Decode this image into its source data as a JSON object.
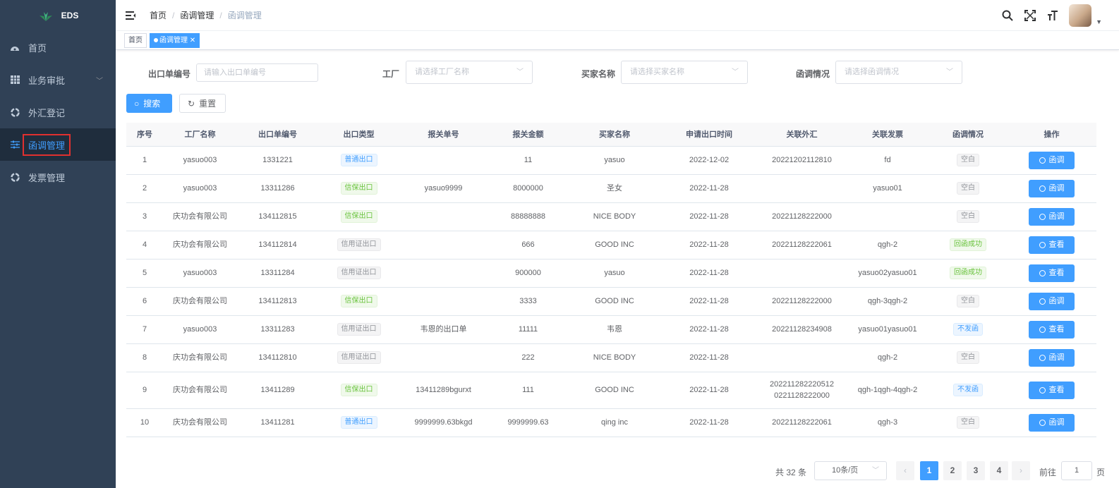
{
  "sidebar": {
    "logo_text": "EDS",
    "items": [
      {
        "label": "首页",
        "icon": "dashboard-icon"
      },
      {
        "label": "业务审批",
        "icon": "table-icon",
        "has_arrow": true
      },
      {
        "label": "外汇登记",
        "icon": "cycle-icon"
      },
      {
        "label": "函调管理",
        "icon": "sliders-icon",
        "active": true
      },
      {
        "label": "发票管理",
        "icon": "cycle-icon"
      }
    ]
  },
  "navbar": {
    "breadcrumb": [
      "首页",
      "函调管理",
      "函调管理"
    ]
  },
  "tags": {
    "home": "首页",
    "active": "函调管理"
  },
  "filters": {
    "export_no": {
      "label": "出口单编号",
      "placeholder": "请输入出口单编号"
    },
    "factory": {
      "label": "工厂",
      "placeholder": "请选择工厂名称"
    },
    "buyer": {
      "label": "买家名称",
      "placeholder": "请选择买家名称"
    },
    "letter_status": {
      "label": "函调情况",
      "placeholder": "请选择函调情况"
    }
  },
  "buttons": {
    "search": "搜索",
    "reset": "重置"
  },
  "table": {
    "headers": [
      "序号",
      "工厂名称",
      "出口单编号",
      "出口类型",
      "报关单号",
      "报关金额",
      "买家名称",
      "申请出口时间",
      "关联外汇",
      "关联发票",
      "函调情况",
      "操作"
    ],
    "rows": [
      {
        "no": "1",
        "factory": "yasuo003",
        "export_no": "1331221",
        "type": "普通出口",
        "type_color": "blue",
        "customs_no": "",
        "amount": "11",
        "buyer": "yasuo",
        "date": "2022-12-02",
        "fx": "20221202112810",
        "invoice": "fd",
        "status": "空白",
        "status_color": "gray",
        "op": "函调"
      },
      {
        "no": "2",
        "factory": "yasuo003",
        "export_no": "13311286",
        "type": "信保出口",
        "type_color": "green",
        "customs_no": "yasuo9999",
        "amount": "8000000",
        "buyer": "圣女",
        "date": "2022-11-28",
        "fx": "",
        "invoice": "yasuo01",
        "status": "空白",
        "status_color": "gray",
        "op": "函调"
      },
      {
        "no": "3",
        "factory": "庆功会有限公司",
        "export_no": "134112815",
        "type": "信保出口",
        "type_color": "green",
        "customs_no": "",
        "amount": "88888888",
        "buyer": "NICE BODY",
        "date": "2022-11-28",
        "fx": "20221128222000",
        "invoice": "",
        "status": "空白",
        "status_color": "gray",
        "op": "函调"
      },
      {
        "no": "4",
        "factory": "庆功会有限公司",
        "export_no": "134112814",
        "type": "信用证出口",
        "type_color": "gray",
        "customs_no": "",
        "amount": "666",
        "buyer": "GOOD INC",
        "date": "2022-11-28",
        "fx": "20221128222061",
        "invoice": "qgh-2",
        "status": "回函成功",
        "status_color": "green",
        "op": "查看"
      },
      {
        "no": "5",
        "factory": "yasuo003",
        "export_no": "13311284",
        "type": "信用证出口",
        "type_color": "gray",
        "customs_no": "",
        "amount": "900000",
        "buyer": "yasuo",
        "date": "2022-11-28",
        "fx": "",
        "invoice": "yasuo02yasuo01",
        "status": "回函成功",
        "status_color": "green",
        "op": "查看"
      },
      {
        "no": "6",
        "factory": "庆功会有限公司",
        "export_no": "134112813",
        "type": "信保出口",
        "type_color": "green",
        "customs_no": "",
        "amount": "3333",
        "buyer": "GOOD INC",
        "date": "2022-11-28",
        "fx": "20221128222000",
        "invoice": "qgh-3qgh-2",
        "status": "空白",
        "status_color": "gray",
        "op": "函调"
      },
      {
        "no": "7",
        "factory": "yasuo003",
        "export_no": "13311283",
        "type": "信用证出口",
        "type_color": "gray",
        "customs_no": "韦恩的出口单",
        "amount": "11111",
        "buyer": "韦恩",
        "date": "2022-11-28",
        "fx": "20221128234908",
        "invoice": "yasuo01yasuo01",
        "status": "不发函",
        "status_color": "blue",
        "op": "查看"
      },
      {
        "no": "8",
        "factory": "庆功会有限公司",
        "export_no": "134112810",
        "type": "信用证出口",
        "type_color": "gray",
        "customs_no": "",
        "amount": "222",
        "buyer": "NICE BODY",
        "date": "2022-11-28",
        "fx": "",
        "invoice": "qgh-2",
        "status": "空白",
        "status_color": "gray",
        "op": "函调"
      },
      {
        "no": "9",
        "factory": "庆功会有限公司",
        "export_no": "13411289",
        "type": "信保出口",
        "type_color": "green",
        "customs_no": "13411289bgurxt",
        "amount": "111",
        "buyer": "GOOD INC",
        "date": "2022-11-28",
        "fx": "202211282220512\n0221128222000",
        "invoice": "qgh-1qgh-4qgh-2",
        "status": "不发函",
        "status_color": "blue",
        "op": "查看"
      },
      {
        "no": "10",
        "factory": "庆功会有限公司",
        "export_no": "13411281",
        "type": "普通出口",
        "type_color": "blue",
        "customs_no": "9999999.63bkgd",
        "amount": "9999999.63",
        "buyer": "qing inc",
        "date": "2022-11-28",
        "fx": "20221128222061",
        "invoice": "qgh-3",
        "status": "空白",
        "status_color": "gray",
        "op": "函调"
      }
    ]
  },
  "pagination": {
    "total": "共 32 条",
    "page_size": "10条/页",
    "pages": [
      "1",
      "2",
      "3",
      "4"
    ],
    "current": "1",
    "goto_label": "前往",
    "goto_value": "1",
    "page_suffix": "页"
  },
  "colors": {
    "sidebar_bg": "#304156",
    "primary": "#409eff",
    "highlight_box": "#e0302f"
  }
}
